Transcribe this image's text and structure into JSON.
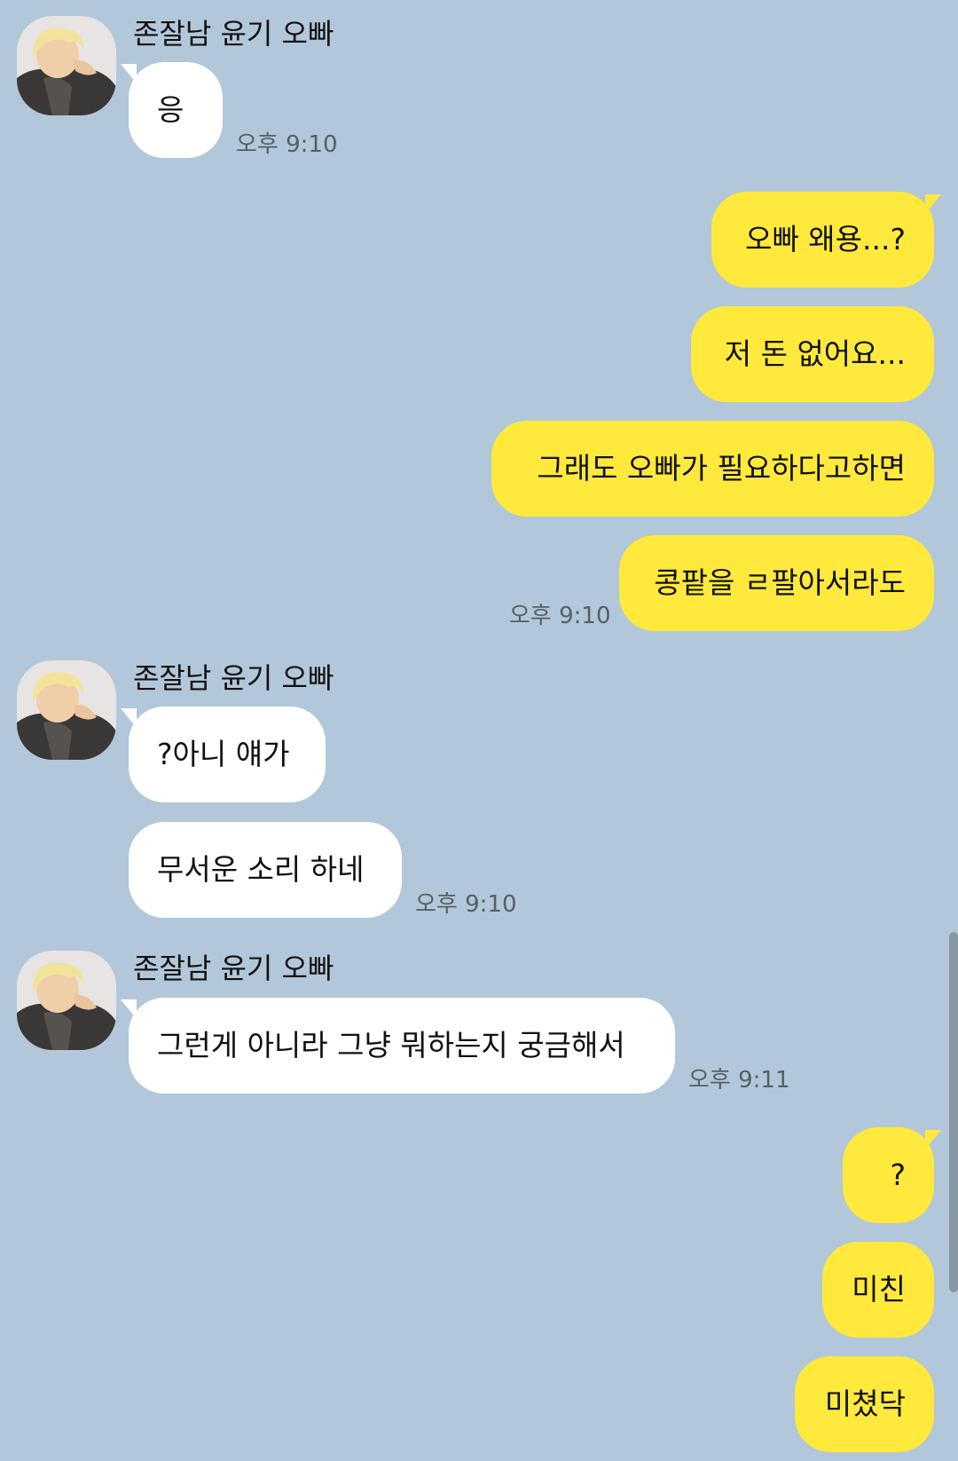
{
  "chat": {
    "contact_name": "존잘남 윤기 오빠",
    "groups": [
      {
        "sender": "존잘남 윤기 오빠",
        "messages": [
          "응"
        ],
        "time": "오후 9:10"
      },
      {
        "sender": "me",
        "messages": [
          "오빠 왜용...?",
          "저 돈 없어요...",
          "그래도 오빠가 필요하다고하면",
          "콩팥을 ㄹ팔아서라도"
        ],
        "time": "오후 9:10"
      },
      {
        "sender": "존잘남 윤기 오빠",
        "messages": [
          "?아니 얘가",
          "무서운 소리 하네"
        ],
        "time": "오후 9:10"
      },
      {
        "sender": "존잘남 윤기 오빠",
        "messages": [
          "그런게 아니라 그냥 뭐하는지 궁금해서"
        ],
        "time": "오후 9:11"
      },
      {
        "sender": "me",
        "messages": [
          "?",
          "미친",
          "미쳤닥"
        ]
      }
    ]
  },
  "colors": {
    "background": "#b2c7da",
    "incoming_bubble": "#ffffff",
    "outgoing_bubble": "#fee93c"
  }
}
